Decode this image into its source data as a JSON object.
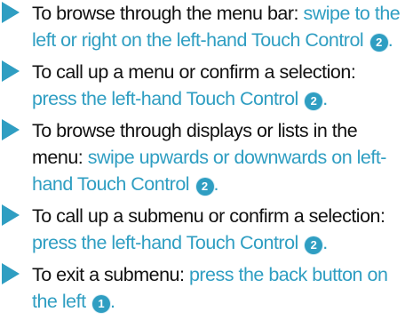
{
  "instructions": [
    {
      "lead": "To browse through the menu bar:",
      "text": " swipe to the left or right on the left-hand Touch Control ",
      "badge": "2",
      "tail": "."
    },
    {
      "lead": "To call up a menu or confirm a selection:",
      "text": " press the left-hand Touch Control ",
      "badge": "2",
      "tail": "."
    },
    {
      "lead": "To browse through displays or lists in the menu:",
      "text": " swipe upwards or downwards on left-hand Touch Control ",
      "badge": "2",
      "tail": "."
    },
    {
      "lead": "To call up a submenu or confirm a selection:",
      "text": " press the left-hand Touch Control ",
      "badge": "2",
      "tail": "."
    },
    {
      "lead": "To exit a submenu:",
      "text": " press the back button on the left ",
      "badge": "1",
      "tail": "."
    }
  ],
  "colors": {
    "accent": "#2f9ec2",
    "lead_text": "#111111"
  },
  "icons": {
    "bullet": "triangle-arrow-icon",
    "reference": "numbered-circle-icon"
  }
}
